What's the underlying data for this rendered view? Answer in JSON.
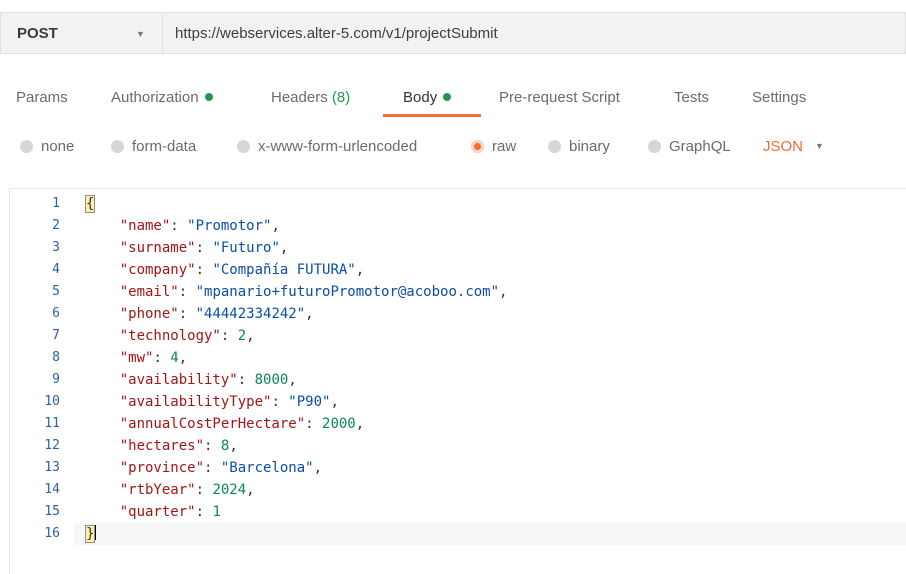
{
  "request": {
    "method": "POST",
    "url": "https://webservices.alter-5.com/v1/projectSubmit"
  },
  "tabs": [
    {
      "label": "Params"
    },
    {
      "label": "Authorization",
      "dot": true
    },
    {
      "label": "Headers",
      "count": "(8)"
    },
    {
      "label": "Body",
      "dot": true,
      "active": true
    },
    {
      "label": "Pre-request Script"
    },
    {
      "label": "Tests"
    },
    {
      "label": "Settings"
    }
  ],
  "body_options": [
    {
      "label": "none"
    },
    {
      "label": "form-data"
    },
    {
      "label": "x-www-form-urlencoded"
    },
    {
      "label": "raw",
      "selected": true
    },
    {
      "label": "binary"
    },
    {
      "label": "GraphQL"
    }
  ],
  "format": "JSON",
  "code": {
    "open": "{",
    "close": "}",
    "entries": [
      {
        "key": "\"name\"",
        "value": "\"Promotor\"",
        "type": "string"
      },
      {
        "key": "\"surname\"",
        "value": "\"Futuro\"",
        "type": "string"
      },
      {
        "key": "\"company\"",
        "value": "\"Compañía FUTURA\"",
        "type": "string"
      },
      {
        "key": "\"email\"",
        "value": "\"mpanario+futuroPromotor@acoboo.com\"",
        "type": "string"
      },
      {
        "key": "\"phone\"",
        "value": "\"44442334242\"",
        "type": "string"
      },
      {
        "key": "\"technology\"",
        "value": "2",
        "type": "number"
      },
      {
        "key": "\"mw\"",
        "value": "4",
        "type": "number"
      },
      {
        "key": "\"availability\"",
        "value": "8000",
        "type": "number"
      },
      {
        "key": "\"availabilityType\"",
        "value": "\"P90\"",
        "type": "string"
      },
      {
        "key": "\"annualCostPerHectare\"",
        "value": "2000",
        "type": "number"
      },
      {
        "key": "\"hectares\"",
        "value": "8",
        "type": "number"
      },
      {
        "key": "\"province\"",
        "value": "\"Barcelona\"",
        "type": "string"
      },
      {
        "key": "\"rtbYear\"",
        "value": "2024",
        "type": "number"
      },
      {
        "key": "\"quarter\"",
        "value": "1",
        "type": "number"
      }
    ],
    "line_numbers": [
      "1",
      "2",
      "3",
      "4",
      "5",
      "6",
      "7",
      "8",
      "9",
      "10",
      "11",
      "12",
      "13",
      "14",
      "15",
      "16"
    ]
  },
  "colors": {
    "accent": "#f26b3a",
    "status_dot": "#1d9b4b",
    "json_key": "#a31515",
    "json_string": "#0a4ea8",
    "json_number": "#098658",
    "line_number": "#2a62a8"
  },
  "icons": {
    "method_dropdown": "chevron-down-icon",
    "format_dropdown": "chevron-down-icon"
  }
}
